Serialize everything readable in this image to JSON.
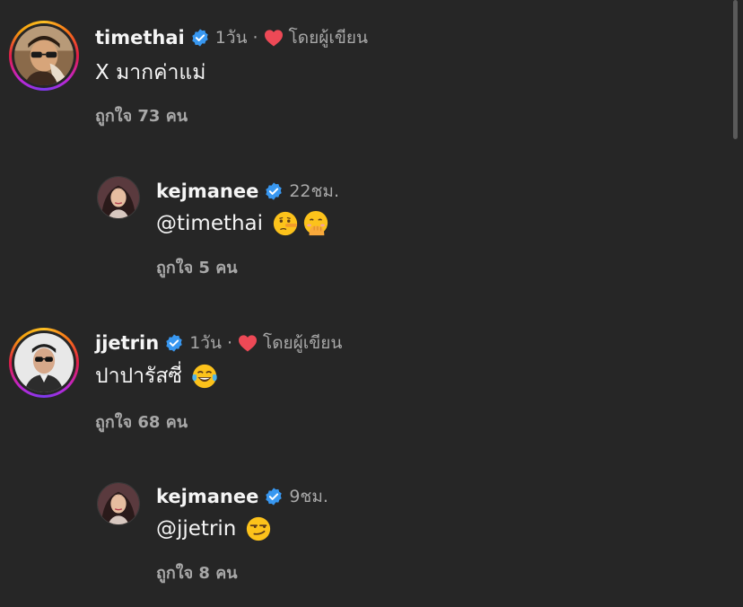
{
  "comments": [
    {
      "username": "timethai",
      "time": "1วัน",
      "by_author": "โดยผู้เขียน",
      "text": "X มากค่าแม่",
      "likes": "ถูกใจ 73 คน"
    },
    {
      "username": "kejmanee",
      "time": "22ชม.",
      "text": "@timethai",
      "emojis": [
        "lying-face",
        "hand-over-mouth-face"
      ],
      "likes": "ถูกใจ 5 คน"
    },
    {
      "username": "jjetrin",
      "time": "1วัน",
      "by_author": "โดยผู้เขียน",
      "text": "ปาปารัสซี่",
      "emojis": [
        "tears-of-joy-face"
      ],
      "likes": "ถูกใจ 68 คน"
    },
    {
      "username": "kejmanee",
      "time": "9ชม.",
      "text": "@jjetrin",
      "emojis": [
        "smirking-face"
      ],
      "likes": "ถูกใจ 8 คน"
    }
  ],
  "colors": {
    "background": "#262626",
    "verified": "#3897f0",
    "heart": "#ed4956",
    "secondary_text": "#a8a8a8"
  }
}
